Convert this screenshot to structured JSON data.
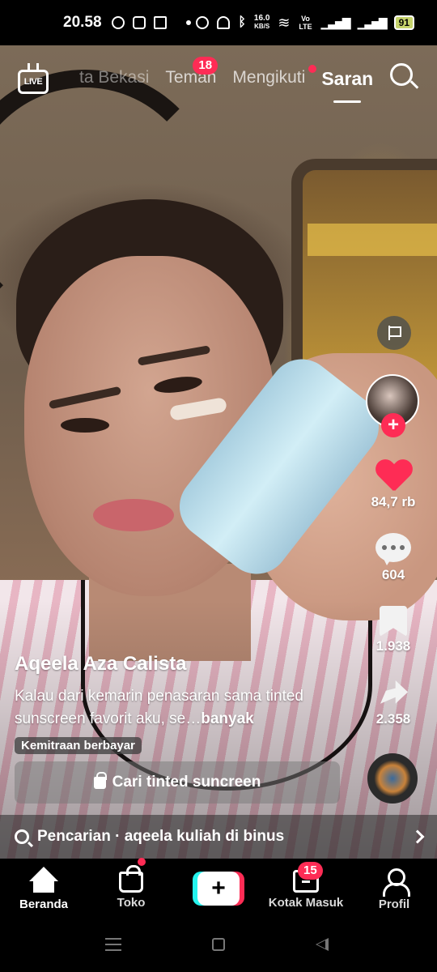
{
  "status_bar": {
    "time": "20.58",
    "left_icons": [
      "whatsapp-icon",
      "instagram-icon",
      "shop-bag-icon",
      "dot-icon"
    ],
    "right_icons": [
      "alarm-icon",
      "mute-icon",
      "bluetooth-icon",
      "network-speed",
      "wifi-icon",
      "volte-icon",
      "signal-icon",
      "signal-icon",
      "battery-icon"
    ],
    "speed_value": "16.0",
    "speed_unit": "KB/S",
    "volte": "Vo LTE",
    "battery": "91"
  },
  "top_nav": {
    "live_label": "LIVE",
    "tabs": [
      {
        "label": "ta Bekasi"
      },
      {
        "label": "Teman",
        "badge": "18"
      },
      {
        "label": "Mengikuti",
        "dot": true
      },
      {
        "label": "Saran",
        "active": true
      }
    ]
  },
  "rail": {
    "like_count": "84,7 rb",
    "comment_count": "604",
    "bookmark_count": "1.938",
    "share_count": "2.358",
    "follow_symbol": "+"
  },
  "caption": {
    "author": "Aqeela Aza Calista",
    "description": "Kalau dari kemarin penasaran sama tinted sunscreen favorit aku, se…",
    "more": "banyak",
    "paid_tag": "Kemitraan berbayar",
    "product_button": "Cari tinted suncreen"
  },
  "search_suggestion": {
    "text": "Pencarian · aqeela kuliah di binus"
  },
  "bottom_nav": {
    "items": [
      {
        "label": "Beranda",
        "active": true
      },
      {
        "label": "Toko",
        "dot": true
      },
      {
        "label": "+"
      },
      {
        "label": "Kotak Masuk",
        "badge": "15"
      },
      {
        "label": "Profil"
      }
    ]
  },
  "colors": {
    "accent": "#fe2c55",
    "accent_cyan": "#25f4ee"
  }
}
